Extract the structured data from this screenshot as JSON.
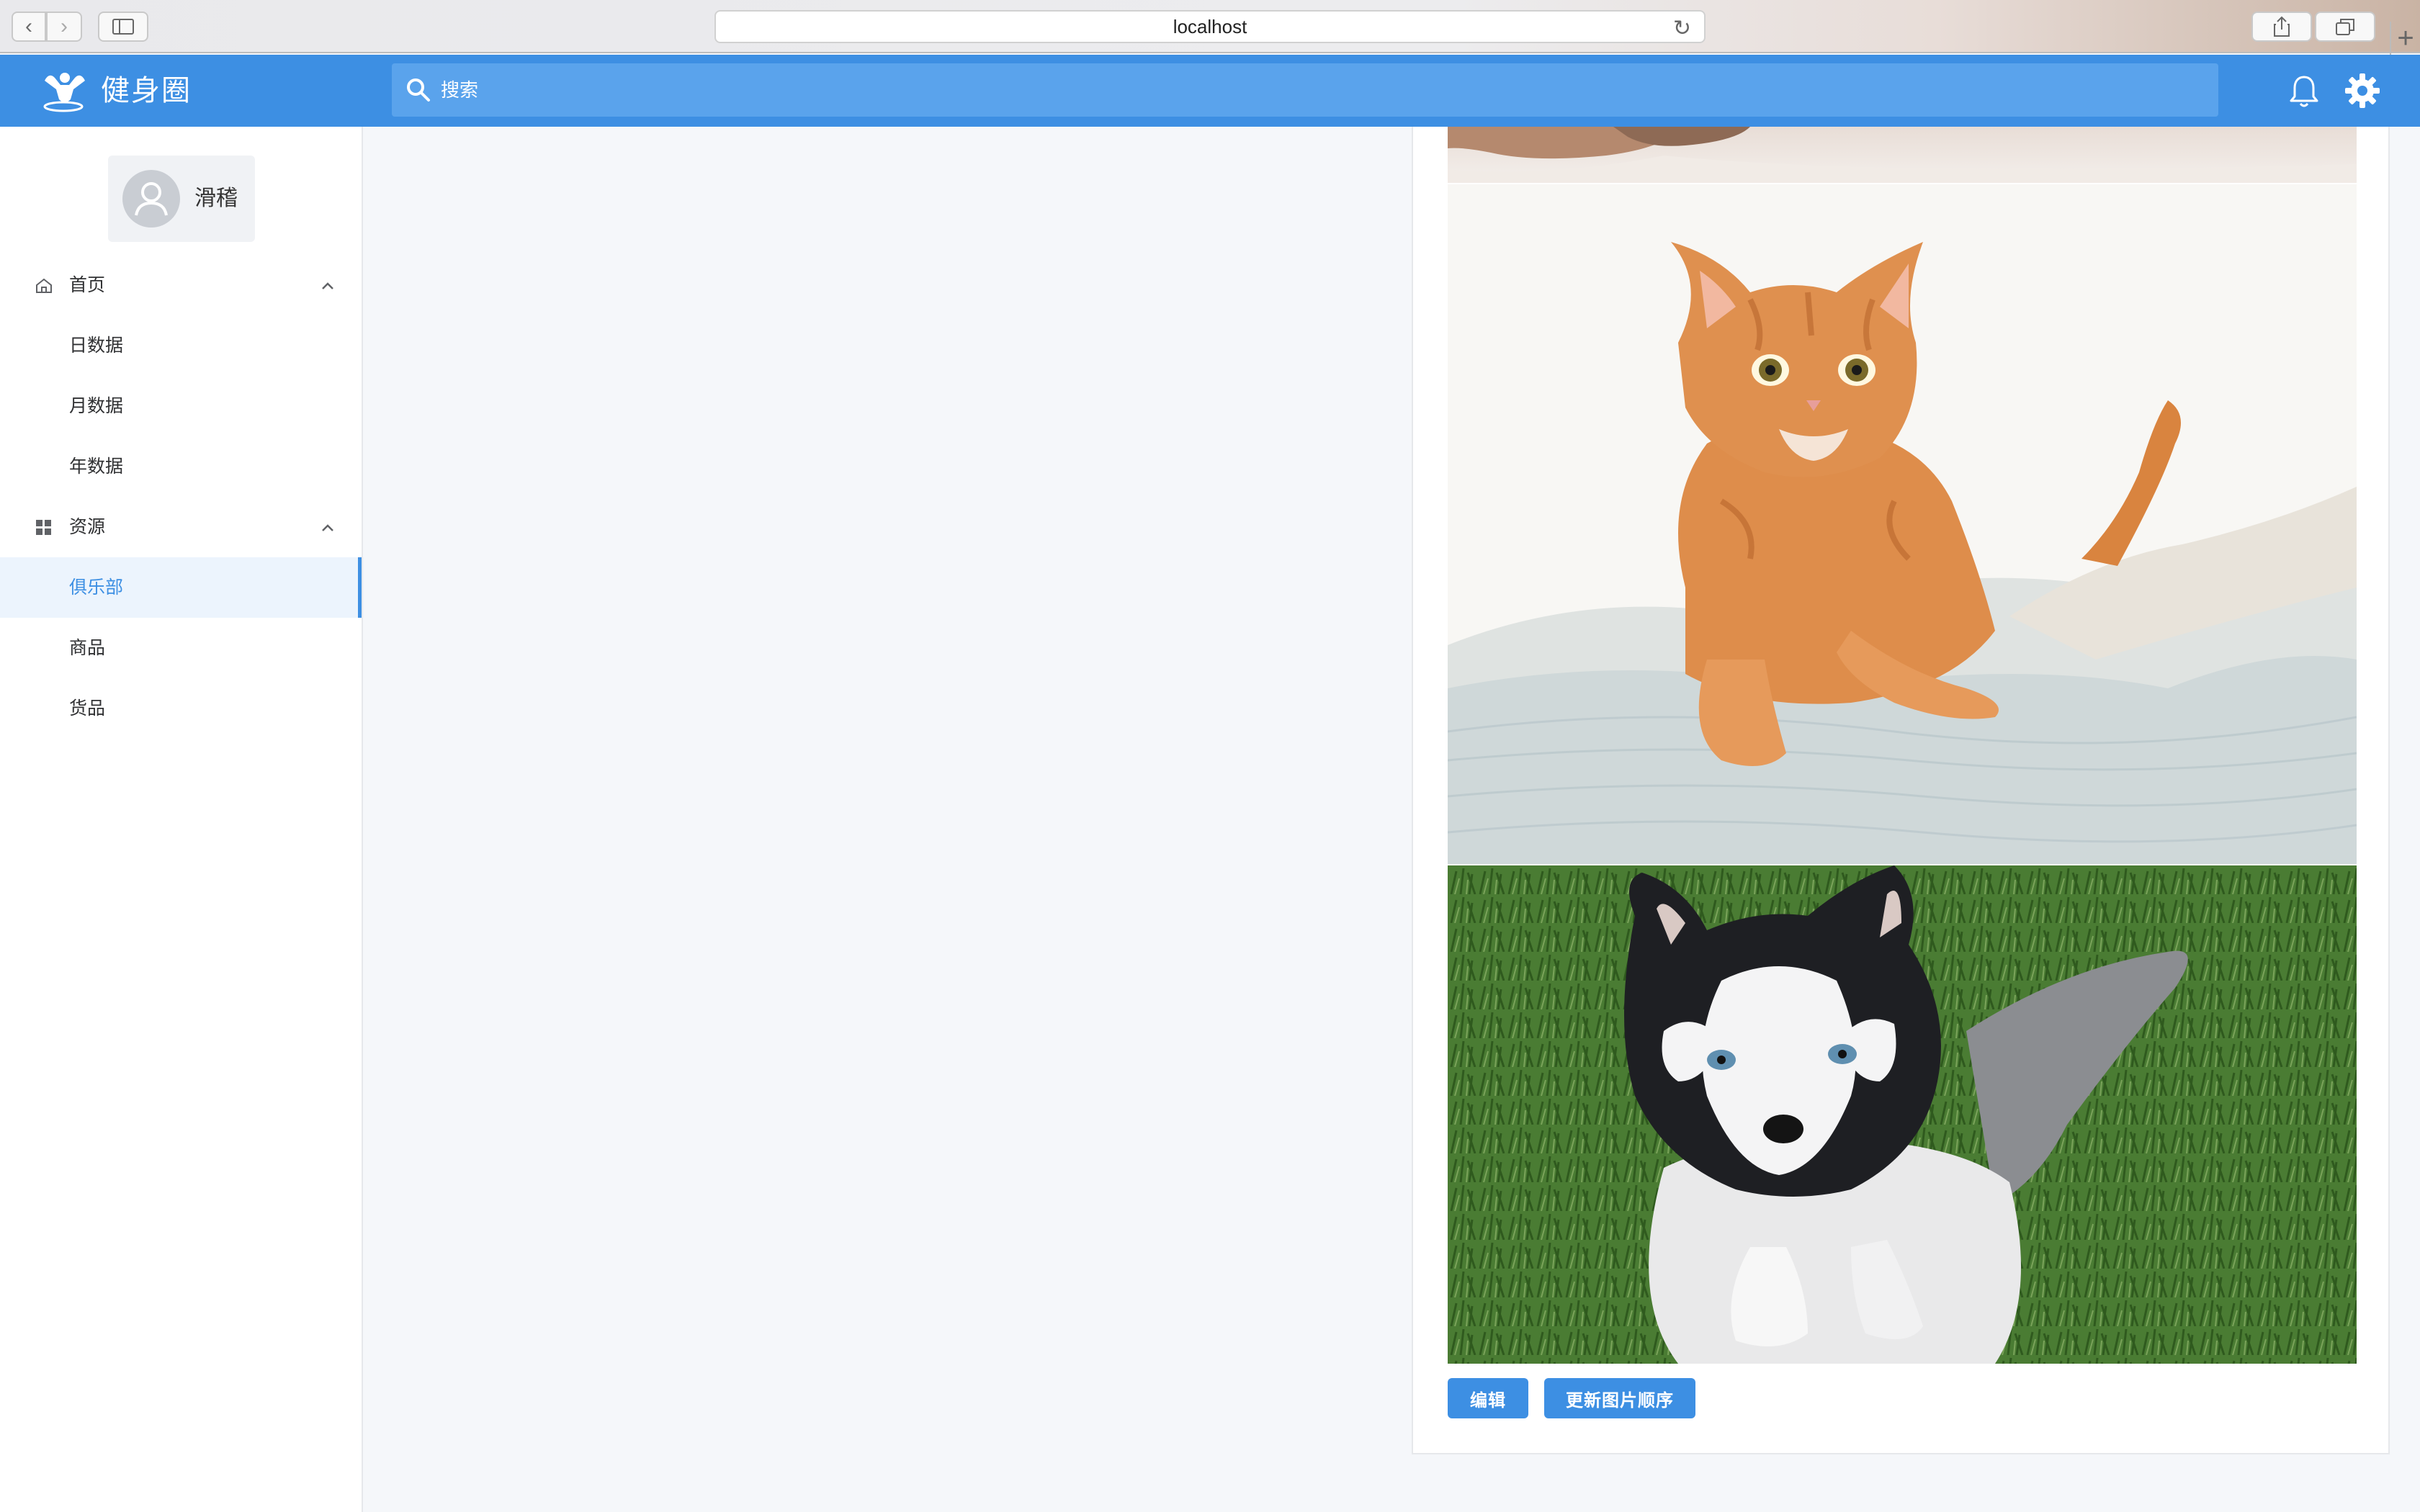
{
  "browser": {
    "url": "localhost"
  },
  "header": {
    "brand": "健身圈",
    "search_placeholder": "搜索"
  },
  "user": {
    "name": "滑稽"
  },
  "menu": {
    "home": {
      "label": "首页",
      "items": [
        "日数据",
        "月数据",
        "年数据"
      ]
    },
    "resources": {
      "label": "资源",
      "items": [
        "俱乐部",
        "商品",
        "货品"
      ],
      "active": "俱乐部"
    }
  },
  "gallery": {
    "images": [
      "cat-image",
      "cat-image",
      "husky-puppy-image"
    ]
  },
  "actions": {
    "edit": "编辑",
    "update_order": "更新图片顺序"
  },
  "colors": {
    "accent": "#3d8fe3",
    "header": "#3d8fe3",
    "search": "#5aa3ec",
    "background": "#f5f7fa"
  }
}
